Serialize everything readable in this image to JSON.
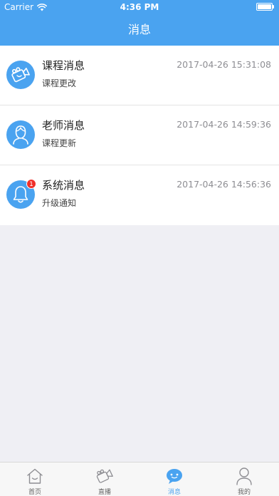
{
  "statusbar": {
    "carrier": "Carrier",
    "time": "4:36 PM",
    "battery_level": 1.0
  },
  "nav": {
    "title": "消息"
  },
  "messages": [
    {
      "title": "课程消息",
      "subtitle": "课程更改",
      "time": "2017-04-26 15:31:08",
      "icon": "video-camera-icon",
      "badge": null
    },
    {
      "title": "老师消息",
      "subtitle": "课程更新",
      "time": "2017-04-26 14:59:36",
      "icon": "person-icon",
      "badge": null
    },
    {
      "title": "系统消息",
      "subtitle": "升级通知",
      "time": "2017-04-26 14:56:36",
      "icon": "bell-icon",
      "badge": "1"
    }
  ],
  "tabs": [
    {
      "label": "首页",
      "icon": "home-icon",
      "active": false
    },
    {
      "label": "直播",
      "icon": "video-camera-icon",
      "active": false
    },
    {
      "label": "消息",
      "icon": "chat-bubble-icon",
      "active": true
    },
    {
      "label": "我的",
      "icon": "person-icon",
      "active": false
    }
  ],
  "colors": {
    "accent": "#4aa3f0",
    "badge": "#f0302b",
    "background": "#efeff4"
  }
}
